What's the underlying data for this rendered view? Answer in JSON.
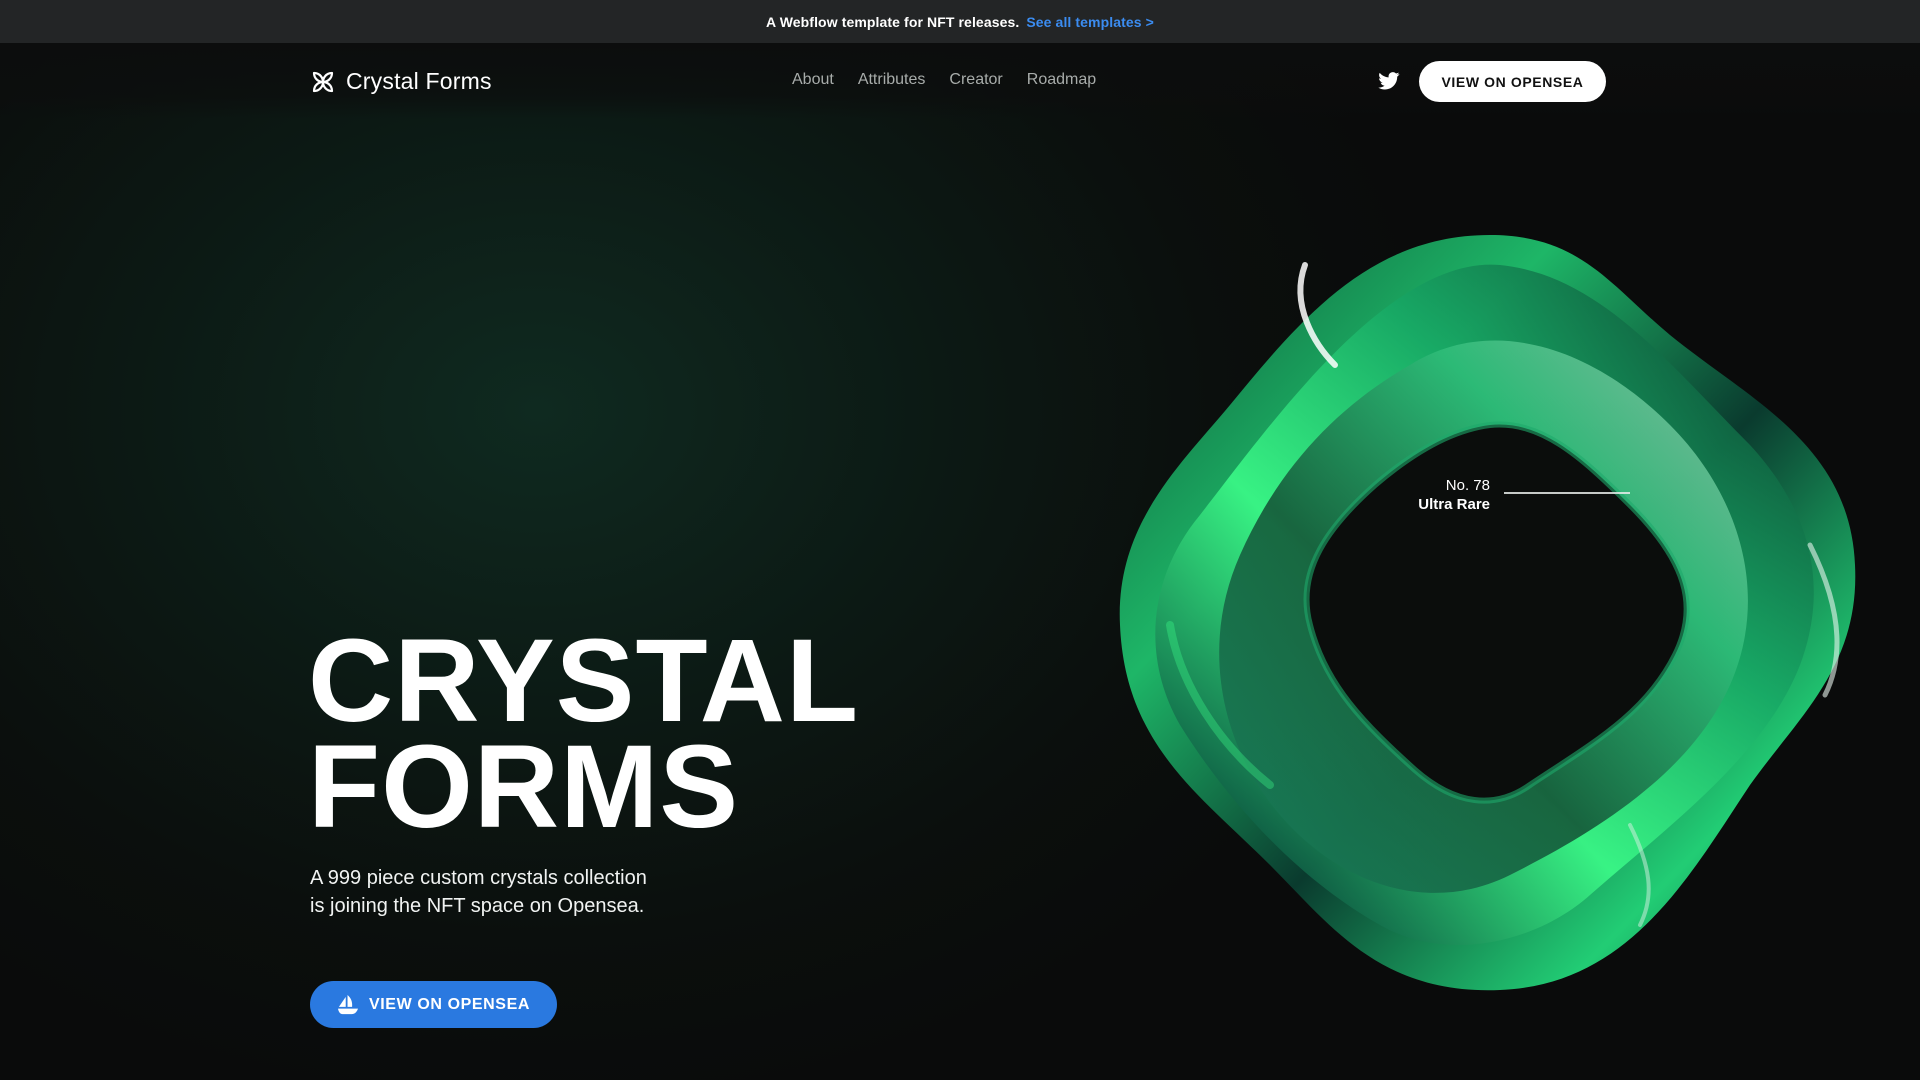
{
  "announcement": {
    "message": "A Webflow template for NFT releases.",
    "link_label": "See all templates >"
  },
  "nav": {
    "brand": "Crystal Forms",
    "links": [
      "About",
      "Attributes",
      "Creator",
      "Roadmap"
    ],
    "social_icon": "twitter-icon",
    "cta_label": "VIEW ON OPENSEA"
  },
  "hero": {
    "title_line1": "CRYSTAL",
    "title_line2": "FORMS",
    "subtitle": "A 999 piece custom crystals collection is joining the NFT space on Opensea.",
    "cta_label": "VIEW ON OPENSEA",
    "cta_icon": "opensea-boat-icon"
  },
  "feature": {
    "number": "No. 78",
    "rarity": "Ultra Rare"
  },
  "colors": {
    "accent_blue": "#2a79e0",
    "link_blue": "#3b8cf0",
    "crystal_green": "#18c86a"
  }
}
